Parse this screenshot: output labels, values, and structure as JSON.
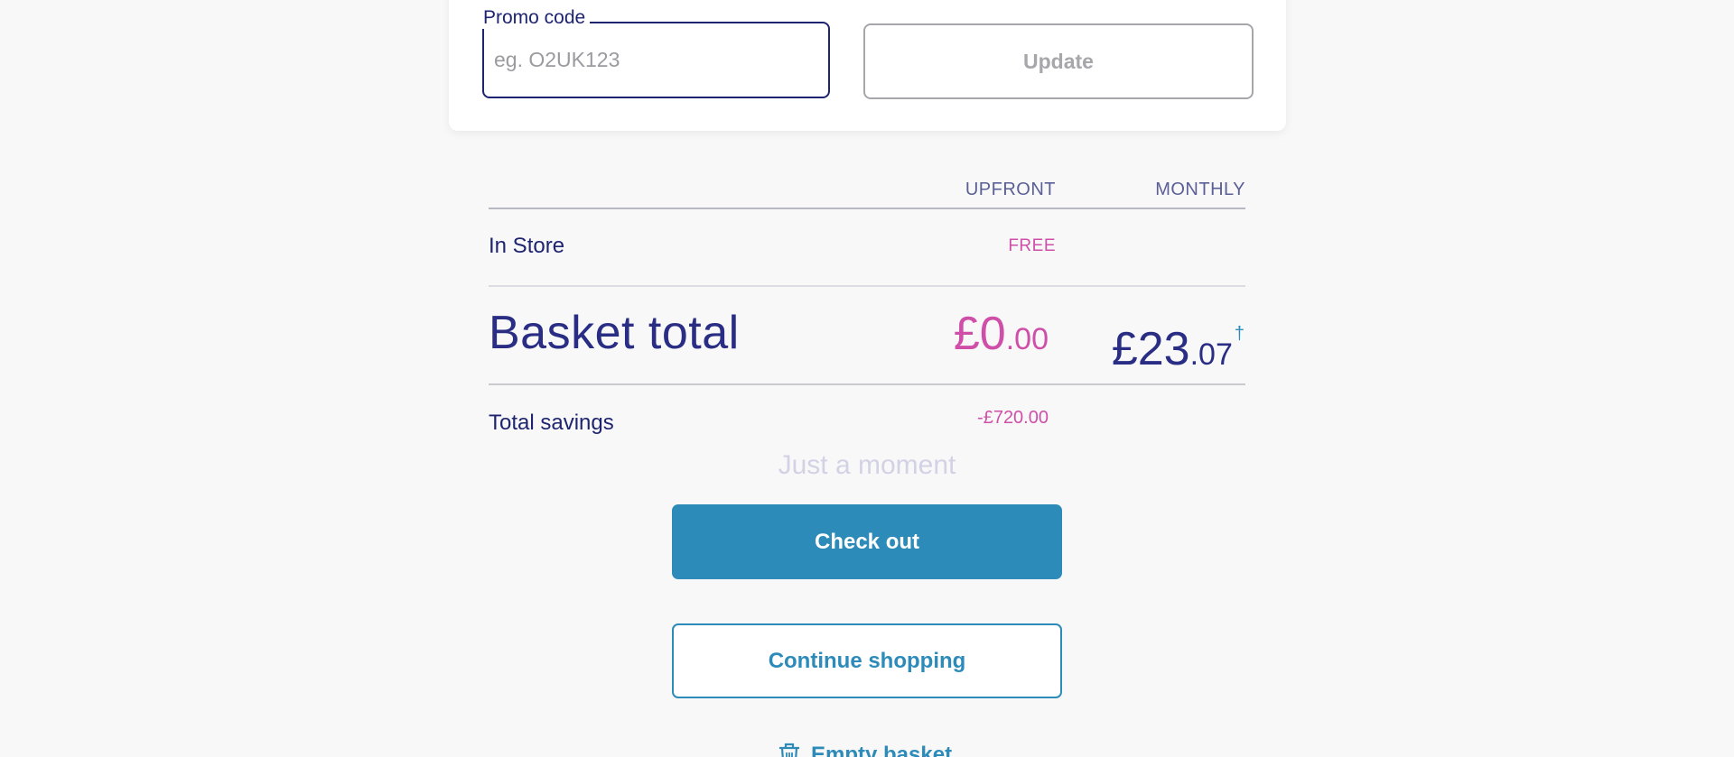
{
  "promo": {
    "label": "Promo code",
    "placeholder": "eg. O2UK123",
    "value": "",
    "update_label": "Update"
  },
  "summary": {
    "columns": {
      "upfront": "UPFRONT",
      "monthly": "MONTHLY"
    },
    "in_store": {
      "label": "In Store",
      "upfront": "FREE"
    },
    "basket_total": {
      "label": "Basket total",
      "upfront_major": "£0",
      "upfront_minor": ".00",
      "monthly_major": "£23",
      "monthly_minor": ".07",
      "monthly_footnote": "†"
    },
    "total_savings": {
      "label": "Total savings",
      "upfront": "-£720.00"
    }
  },
  "status": {
    "loading_text": "Just a moment"
  },
  "actions": {
    "checkout_label": "Check out",
    "continue_label": "Continue shopping",
    "empty_basket_label": "Empty basket",
    "empty_basket_icon": "trash-icon"
  },
  "colors": {
    "brand_navy": "#1e2470",
    "accent_blue": "#2d8bb9",
    "accent_pink": "#cf4fa8"
  }
}
